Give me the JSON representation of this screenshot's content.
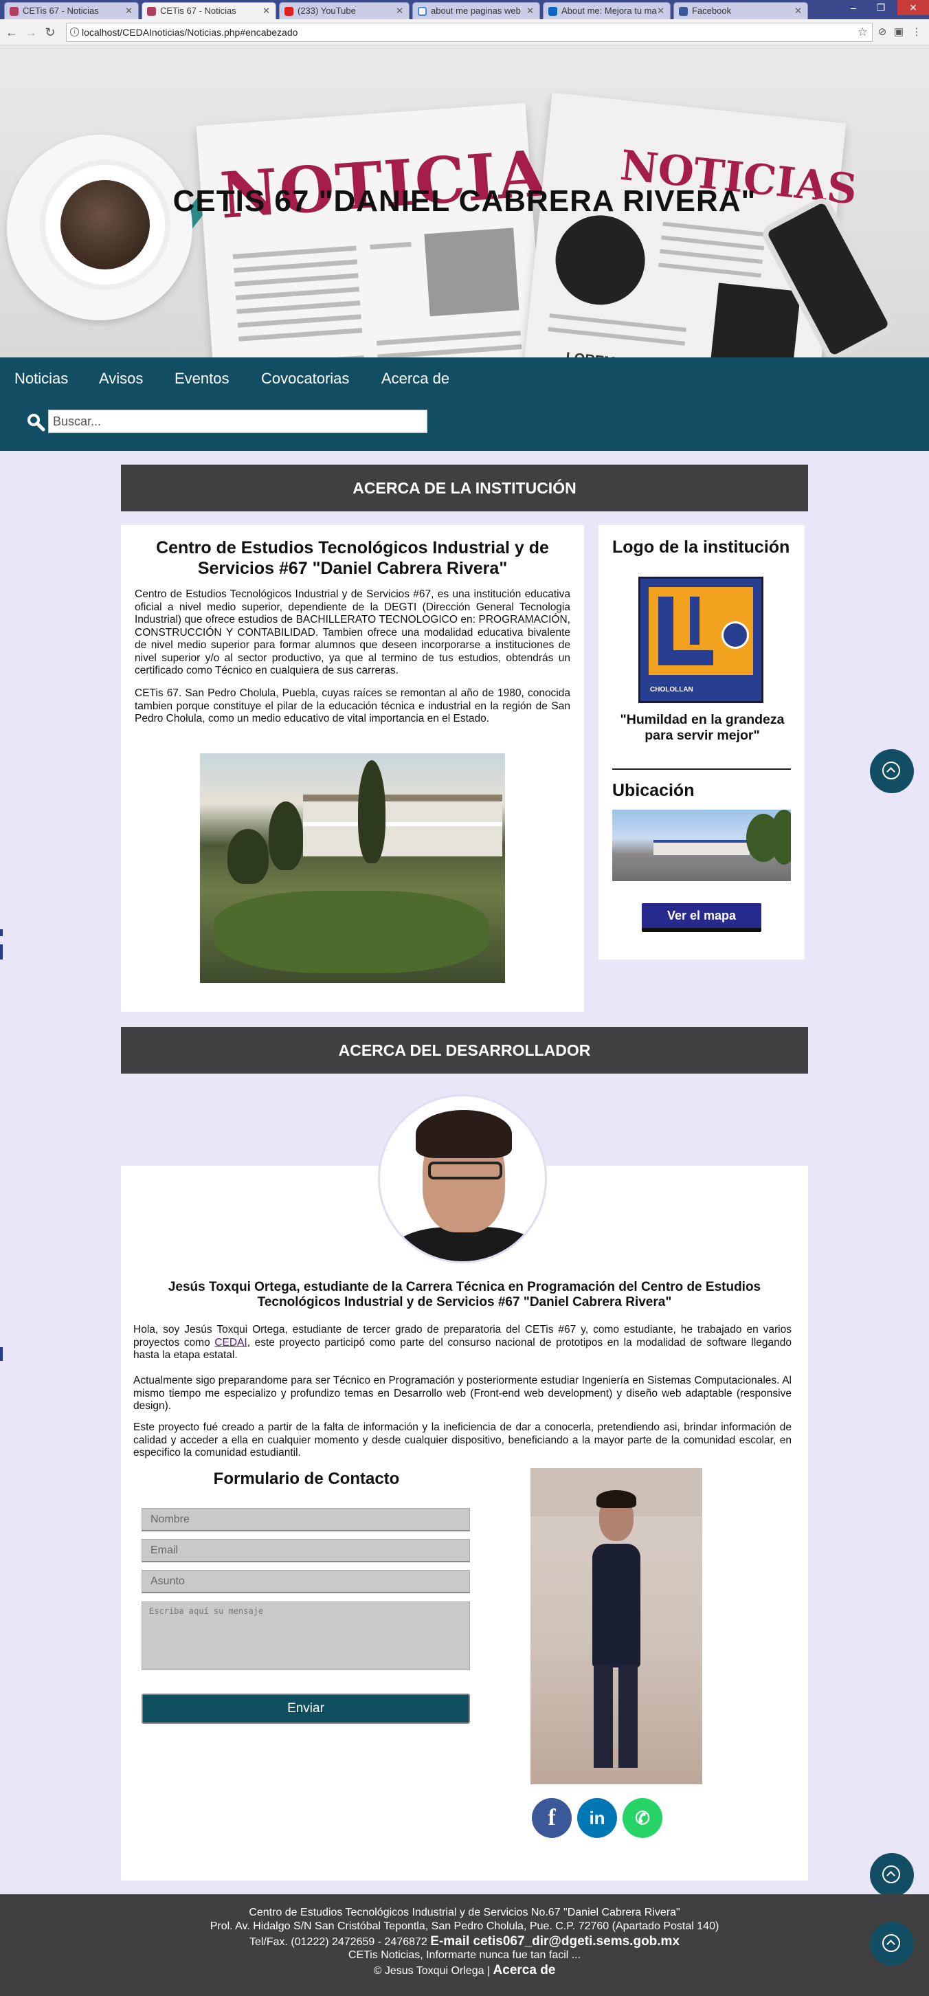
{
  "browser": {
    "tabs": [
      {
        "label": "CETis 67 - Noticias",
        "favicon": "cetis-icon"
      },
      {
        "label": "CETis 67 - Noticias",
        "favicon": "cetis-icon"
      },
      {
        "label": "(233) YouTube",
        "favicon": "youtube-icon"
      },
      {
        "label": "about me paginas web",
        "favicon": "google-icon"
      },
      {
        "label": "About me: Mejora tu ma",
        "favicon": "linkedin-icon"
      },
      {
        "label": "Facebook",
        "favicon": "facebook-icon"
      }
    ],
    "active_tab": 1,
    "url": "localhost/CEDAInoticias/Noticias.php#encabezado"
  },
  "header": {
    "site_title": "CETIS 67 \"DANIEL CABRERA RIVERA\"",
    "banner_newspaper_word": "NOTICIAS",
    "banner_lorem": "LOREM IPSUM"
  },
  "nav": {
    "items": [
      "Noticias",
      "Avisos",
      "Eventos",
      "Covocatorias",
      "Acerca de"
    ],
    "search_placeholder": "Buscar..."
  },
  "about_institution": {
    "section_title": "ACERCA DE LA INSTITUCIÓN",
    "title": "Centro de Estudios Tecnológicos Industrial y de Servicios #67 \"Daniel Cabrera Rivera\"",
    "paragraph_1": "Centro de Estudios Tecnológicos Industrial y de Servicios #67, es una institución educativa oficial a nivel medio superior, dependiente de la DEGTI (Dirección General Tecnologia Industrial) que ofrece estudios de BACHILLERATO TECNOLOGICO en: PROGRAMACIÓN, CONSTRUCCIÓN Y CONTABILIDAD. Tambien ofrece una modalidad educativa bivalente de nivel medio superior para formar alumnos que deseen incorporarse a instituciones de nivel superior y/o al sector productivo, ya que al termino de tus estudios, obtendrás un certificado como Técnico en cualquiera de sus carreras.",
    "paragraph_2": "CETis 67. San Pedro Cholula, Puebla, cuyas raíces se remontan al año de 1980, conocida tambien porque constituye el pilar de la educación técnica e industrial en la región de San Pedro Cholula, como un medio educativo de vital importancia en el Estado."
  },
  "sidebar": {
    "logo_title": "Logo de la institución",
    "logo_caption": "CHOLOLLAN",
    "logo_number": "67",
    "motto": "\"Humildad en la grandeza para servir mejor\"",
    "location_title": "Ubicación",
    "map_button": "Ver el mapa"
  },
  "about_developer": {
    "section_title": "ACERCA DEL DESARROLLADOR",
    "title": "Jesús Toxqui Ortega, estudiante de la Carrera Técnica en Programación del Centro de Estudios Tecnológicos Industrial y de Servicios #67 \"Daniel Cabrera Rivera\"",
    "paragraph_1_a": "Hola, soy Jesús Toxqui Ortega, estudiante de tercer grado de preparatoria del CETis #67 y, como estudiante, he trabajado en varios proyectos como ",
    "paragraph_1_link": "CEDAI",
    "paragraph_1_b": ", este proyecto participó como parte del consurso nacional de prototipos en la modalidad de software llegando hasta la etapa estatal.",
    "paragraph_2": "Actualmente sigo preparandome para ser Técnico en Programación y posteriormente estudiar Ingeniería en Sistemas Computacionales. Al mismo tiempo me especializo y profundizo temas en Desarrollo web (Front-end web development) y diseño web adaptable (responsive design).",
    "paragraph_3": "Este proyecto fué creado a partir de la falta de información y la ineficiencia de dar a conocerla, pretendiendo asi, brindar información de calidad y acceder a ella en cualquier momento y desde cualquier dispositivo, beneficiando a la mayor parte de la comunidad escolar, en especifico la comunidad estudiantil."
  },
  "contact_form": {
    "title": "Formulario de Contacto",
    "name_placeholder": "Nombre",
    "email_placeholder": "Email",
    "subject_placeholder": "Asunto",
    "message_placeholder": "Escriba aquí su mensaje",
    "submit_label": "Enviar"
  },
  "social": {
    "facebook": "f",
    "linkedin": "in",
    "whatsapp": "✆"
  },
  "footer": {
    "line_1": "Centro de Estudios Tecnológicos Industrial y de Servicios No.67 \"Daniel Cabrera Rivera\"",
    "line_2": "Prol. Av. Hidalgo S/N San Cristóbal Tepontla, San Pedro Cholula, Pue. C.P. 72760 (Apartado Postal 140)",
    "line_3_a": "Tel/Fax. (01222) 2472659 - 2476872 ",
    "line_3_b": "E-mail cetis067_dir@dgeti.sems.gob.mx",
    "line_4": "CETis Noticias, Informarte nunca fue tan facil ...",
    "line_5_a": "© Jesus Toxqui Orlega | ",
    "line_5_b": "Acerca de"
  },
  "colors": {
    "nav_bg": "#124e63",
    "section_header_bg": "#404040",
    "page_bg": "#e8e6f7",
    "map_button_bg": "#272a8c"
  }
}
